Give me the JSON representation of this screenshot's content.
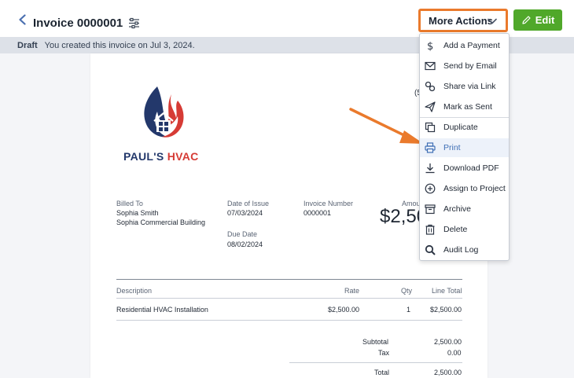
{
  "header": {
    "title": "Invoice 0000001",
    "more_actions_label": "More Actions",
    "edit_label": "Edit"
  },
  "status": {
    "badge": "Draft",
    "message": "You created this invoice on Jul 3, 2024."
  },
  "invoice": {
    "brand_first": "PAUL'S",
    "brand_second": "HVAC",
    "phone_fragment": "(5",
    "billed_to_label": "Billed To",
    "billed_to_name": "Sophia Smith",
    "billed_to_company": "Sophia Commercial Building",
    "date_of_issue_label": "Date of Issue",
    "date_of_issue": "07/03/2024",
    "due_date_label": "Due Date",
    "due_date": "08/02/2024",
    "invoice_number_label": "Invoice Number",
    "invoice_number": "0000001",
    "amount_label_fragment": "Amou",
    "amount_fragment": "$2,50",
    "table": {
      "headers": [
        "Description",
        "Rate",
        "Qty",
        "Line Total"
      ],
      "rows": [
        [
          "Residential HVAC Installation",
          "$2,500.00",
          "1",
          "$2,500.00"
        ]
      ]
    },
    "subtotal_label": "Subtotal",
    "subtotal": "2,500.00",
    "tax_label": "Tax",
    "tax": "0.00",
    "total_label": "Total",
    "total": "2,500.00"
  },
  "menu": {
    "items": [
      {
        "label": "Add a Payment",
        "icon": "dollar-icon"
      },
      {
        "label": "Send by Email",
        "icon": "envelope-icon"
      },
      {
        "label": "Share via Link",
        "icon": "link-icon"
      },
      {
        "label": "Mark as Sent",
        "icon": "send-icon"
      },
      {
        "label": "Duplicate",
        "icon": "duplicate-icon"
      },
      {
        "label": "Print",
        "icon": "printer-icon",
        "highlighted": true
      },
      {
        "label": "Download PDF",
        "icon": "download-icon"
      },
      {
        "label": "Assign to Project",
        "icon": "plus-circle-icon"
      },
      {
        "label": "Archive",
        "icon": "archive-icon"
      },
      {
        "label": "Delete",
        "icon": "trash-icon"
      },
      {
        "label": "Audit Log",
        "icon": "search-icon"
      }
    ]
  },
  "colors": {
    "highlight_border": "#ea7a2c",
    "edit_button": "#50a82a",
    "brand_navy": "#23386b",
    "brand_red": "#d63b35",
    "annotation_arrow": "#ea7a2c"
  }
}
